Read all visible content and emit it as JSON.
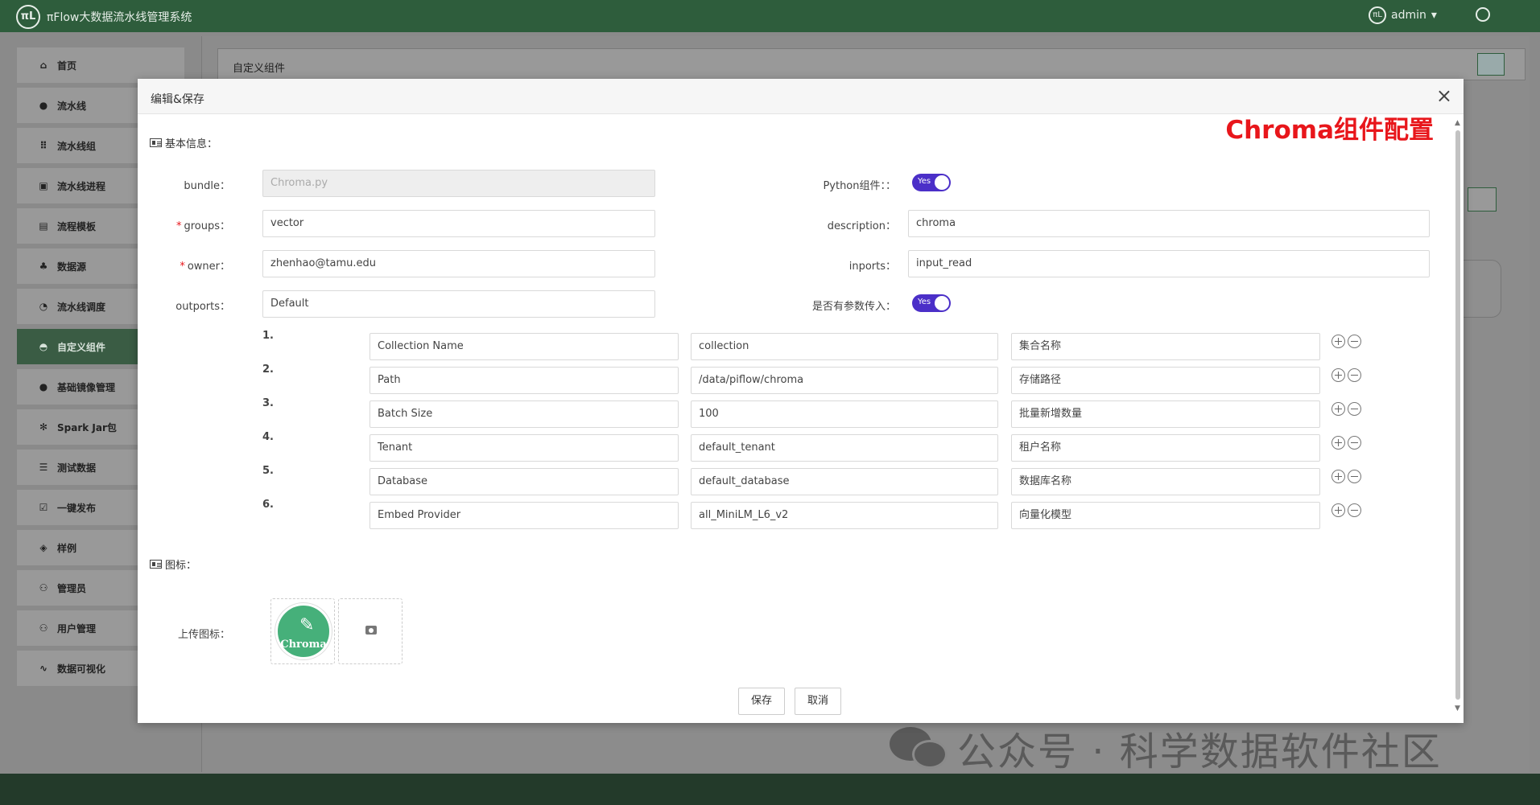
{
  "app": {
    "title": "πFlow大数据流水线管理系统",
    "logo": "πL",
    "user": "admin",
    "user_icon": "πL"
  },
  "sidebar": {
    "items": [
      {
        "label": "首页",
        "icon": "home-icon",
        "glyph": "⌂"
      },
      {
        "label": "流水线",
        "icon": "pipeline-icon",
        "glyph": "●"
      },
      {
        "label": "流水线组",
        "icon": "grid-icon",
        "glyph": "⠿"
      },
      {
        "label": "流水线进程",
        "icon": "process-icon",
        "glyph": "▣"
      },
      {
        "label": "流程模板",
        "icon": "template-icon",
        "glyph": "▤"
      },
      {
        "label": "数据源",
        "icon": "datasource-icon",
        "glyph": "♣"
      },
      {
        "label": "流水线调度",
        "icon": "schedule-icon",
        "glyph": "◔"
      },
      {
        "label": "自定义组件",
        "icon": "custom-component-icon",
        "glyph": "◓",
        "active": true
      },
      {
        "label": "基础镜像管理",
        "icon": "image-icon",
        "glyph": "●"
      },
      {
        "label": "Spark Jar包",
        "icon": "gear-icon",
        "glyph": "✻"
      },
      {
        "label": "测试数据",
        "icon": "list-icon",
        "glyph": "☰"
      },
      {
        "label": "一键发布",
        "icon": "checkbox-icon",
        "glyph": "☑"
      },
      {
        "label": "样例",
        "icon": "cube-icon",
        "glyph": "◈"
      },
      {
        "label": "管理员",
        "icon": "admins-icon",
        "glyph": "⚇"
      },
      {
        "label": "用户管理",
        "icon": "users-icon",
        "glyph": "⚇"
      },
      {
        "label": "数据可视化",
        "icon": "pulse-icon",
        "glyph": "∿"
      }
    ]
  },
  "main": {
    "header_title": "自定义组件"
  },
  "modal": {
    "title": "编辑&保存",
    "annotation": "Chroma组件配置",
    "basic_info_label": "基本信息：",
    "fields": {
      "bundle": {
        "label": "bundle：",
        "value": "Chroma.py"
      },
      "python": {
        "label": "Python组件：：",
        "toggle": "Yes"
      },
      "groups": {
        "label": "groups：",
        "value": "vector",
        "required": "*"
      },
      "description": {
        "label": "description：",
        "value": "chroma"
      },
      "owner": {
        "label": "owner：",
        "value": "zhenhao@tamu.edu",
        "required": "*"
      },
      "inports": {
        "label": "inports：",
        "value": "input_read"
      },
      "outports": {
        "label": "outports：",
        "value": "Default"
      },
      "has_params": {
        "label": "是否有参数传入：",
        "toggle": "Yes"
      }
    },
    "params": [
      {
        "num": "1.",
        "name": "Collection Name",
        "value": "collection",
        "desc": "集合名称"
      },
      {
        "num": "2.",
        "name": "Path",
        "value": "/data/piflow/chroma",
        "desc": "存储路径"
      },
      {
        "num": "3.",
        "name": "Batch Size",
        "value": "100",
        "desc": "批量新增数量"
      },
      {
        "num": "4.",
        "name": "Tenant",
        "value": "default_tenant",
        "desc": "租户名称"
      },
      {
        "num": "5.",
        "name": "Database",
        "value": "default_database",
        "desc": "数据库名称"
      },
      {
        "num": "6.",
        "name": "Embed Provider",
        "value": "all_MiniLM_L6_v2",
        "desc": "向量化模型"
      }
    ],
    "icon_section_label": "图标：",
    "upload_label": "上传图标：",
    "chroma_icon_text": "Chroma",
    "save_label": "保存",
    "cancel_label": "取消",
    "close_glyph": "×"
  },
  "watermark": {
    "text": "公众号 · 科学数据软件社区"
  },
  "colors": {
    "topbar": "#2e5d3c",
    "accent_toggle": "#4b2fc8",
    "annotation_red": "#e8161b",
    "chroma_green": "#46b07a"
  }
}
